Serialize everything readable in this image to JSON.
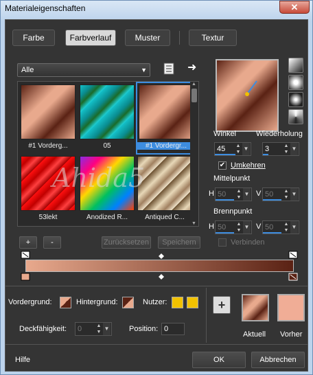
{
  "window": {
    "title": "Materialeigenschaften",
    "close_glyph": "✕"
  },
  "tabs": [
    {
      "label": "Farbe"
    },
    {
      "label": "Farbverlauf"
    },
    {
      "label": "Muster"
    },
    {
      "label": "Textur"
    }
  ],
  "category": {
    "value": "Alle"
  },
  "gallery": {
    "items": [
      {
        "label": "#1 Vorderg..."
      },
      {
        "label": "05"
      },
      {
        "label": "#1 Vordergr..."
      },
      {
        "label": "53lekt"
      },
      {
        "label": "Anodized R..."
      },
      {
        "label": "Antiqued C..."
      }
    ]
  },
  "gallery_buttons": {
    "add": "+",
    "remove": "-",
    "reset": "Zurücksetzen",
    "save": "Speichern"
  },
  "angle": {
    "label": "Winkel",
    "value": "45"
  },
  "repeat": {
    "label": "Wiederholung",
    "value": "3"
  },
  "invert": {
    "label": "Umkehren",
    "checked": true
  },
  "midpoint": {
    "label": "Mittelpunkt",
    "h_label": "H",
    "h_value": "50",
    "v_label": "V",
    "v_value": "50"
  },
  "focal": {
    "label": "Brennpunkt",
    "h_label": "H",
    "h_value": "50",
    "v_label": "V",
    "v_value": "50"
  },
  "link": {
    "label": "Verbinden",
    "checked": false
  },
  "colors": {
    "foreground_label": "Vordergrund:",
    "background_label": "Hintergrund:",
    "user_label": "Nutzer:",
    "foreground": "#e8a98d",
    "background": "#5a2214",
    "user": "#f2c200"
  },
  "opacity": {
    "label": "Deckfähigkeit:",
    "value": "0"
  },
  "position": {
    "label": "Position:",
    "value": "0"
  },
  "current": {
    "label": "Aktuell"
  },
  "previous": {
    "label": "Vorher",
    "color": "#f0ad96"
  },
  "footer": {
    "help": "Hilfe",
    "ok": "OK",
    "cancel": "Abbrechen"
  },
  "watermark": {
    "text": "Ahida5"
  }
}
